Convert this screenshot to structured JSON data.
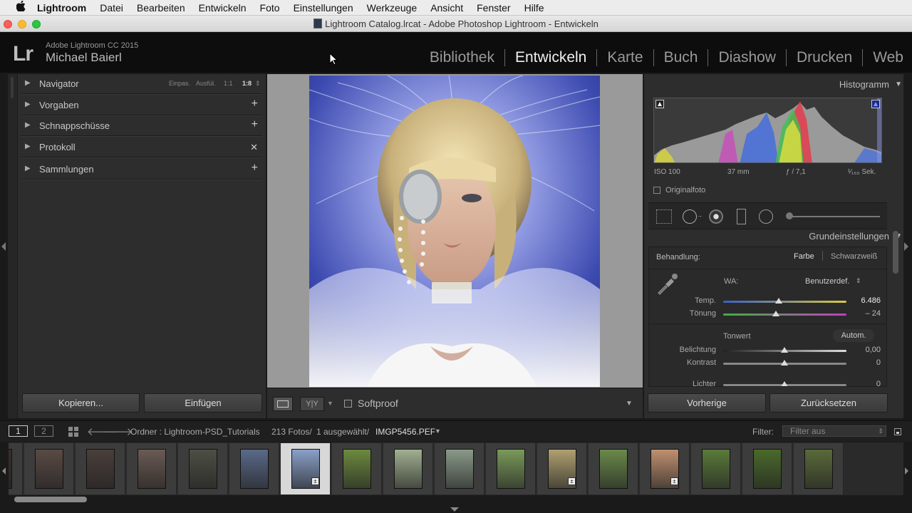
{
  "menubar": {
    "apple": "",
    "items": [
      "Lightroom",
      "Datei",
      "Bearbeiten",
      "Entwickeln",
      "Foto",
      "Einstellungen",
      "Werkzeuge",
      "Ansicht",
      "Fenster",
      "Hilfe"
    ]
  },
  "window": {
    "title": "Lightroom Catalog.lrcat - Adobe Photoshop Lightroom - Entwickeln"
  },
  "identity": {
    "logo": "Lr",
    "product": "Adobe Lightroom CC 2015",
    "user": "Michael Baierl"
  },
  "modules": [
    "Bibliothek",
    "Entwickeln",
    "Karte",
    "Buch",
    "Diashow",
    "Drucken",
    "Web"
  ],
  "left_panel": {
    "navigator": {
      "label": "Navigator",
      "options": [
        "Einpas.",
        "Ausfül.",
        "1:1",
        "1:8"
      ]
    },
    "items": [
      {
        "label": "Vorgaben",
        "action": "+"
      },
      {
        "label": "Schnappschüsse",
        "action": "+"
      },
      {
        "label": "Protokoll",
        "action": "✕"
      },
      {
        "label": "Sammlungen",
        "action": "+"
      }
    ],
    "copy_button": "Kopieren...",
    "paste_button": "Einfügen"
  },
  "toolbar": {
    "softproof": "Softproof",
    "yy": "Y|Y"
  },
  "right_panel": {
    "histogram": {
      "title": "Histogramm",
      "iso": "ISO 100",
      "focal": "37 mm",
      "aperture": "ƒ / 7,1",
      "shutter": "¹⁄₁₆₀ Sek.",
      "original": "Originalfoto"
    },
    "basic": {
      "title": "Grundeinstellungen",
      "treatment_label": "Behandlung:",
      "color": "Farbe",
      "bw": "Schwarzweiß",
      "wb_label": "WA:",
      "wb_value": "Benutzerdef.",
      "temp_label": "Temp.",
      "temp_value": "6.486",
      "temp_pos": 0.45,
      "tint_label": "Tönung",
      "tint_value": "– 24",
      "tint_pos": 0.43,
      "tone_label": "Tonwert",
      "auto": "Autom.",
      "exposure_label": "Belichtung",
      "exposure_value": "0,00",
      "contrast_label": "Kontrast",
      "contrast_value": "0",
      "highlights_label": "Lichter",
      "highlights_value": "0"
    },
    "prev_button": "Vorherige",
    "reset_button": "Zurücksetzen"
  },
  "filmstrip": {
    "page1": "1",
    "page2": "2",
    "source_prefix": "Ordner : Lightroom-PSD_Tutorials",
    "count": "213 Fotos/",
    "selected": "1 ausgewählt/",
    "filename": "IMGP5456.PEF",
    "filter_label": "Filter:",
    "filter_value": "Filter aus",
    "thumbs": [
      {
        "c": "#3a2e2a"
      },
      {
        "c": "#5a4a44"
      },
      {
        "c": "#4a3e3a"
      },
      {
        "c": "#6a5a54"
      },
      {
        "c": "#4d4f44"
      },
      {
        "c": "#5a6a8a"
      },
      {
        "c": "#8aa0c8",
        "sel": true,
        "badge": true
      },
      {
        "c": "#6c8a3e"
      },
      {
        "c": "#a0b090"
      },
      {
        "c": "#8a9a8a"
      },
      {
        "c": "#7a9a5a"
      },
      {
        "c": "#b0a070",
        "badge": true
      },
      {
        "c": "#6a8a4a"
      },
      {
        "c": "#c09070",
        "badge": true
      },
      {
        "c": "#5a7a3a"
      },
      {
        "c": "#4a6a2a"
      },
      {
        "c": "#5a6a3a"
      }
    ]
  }
}
